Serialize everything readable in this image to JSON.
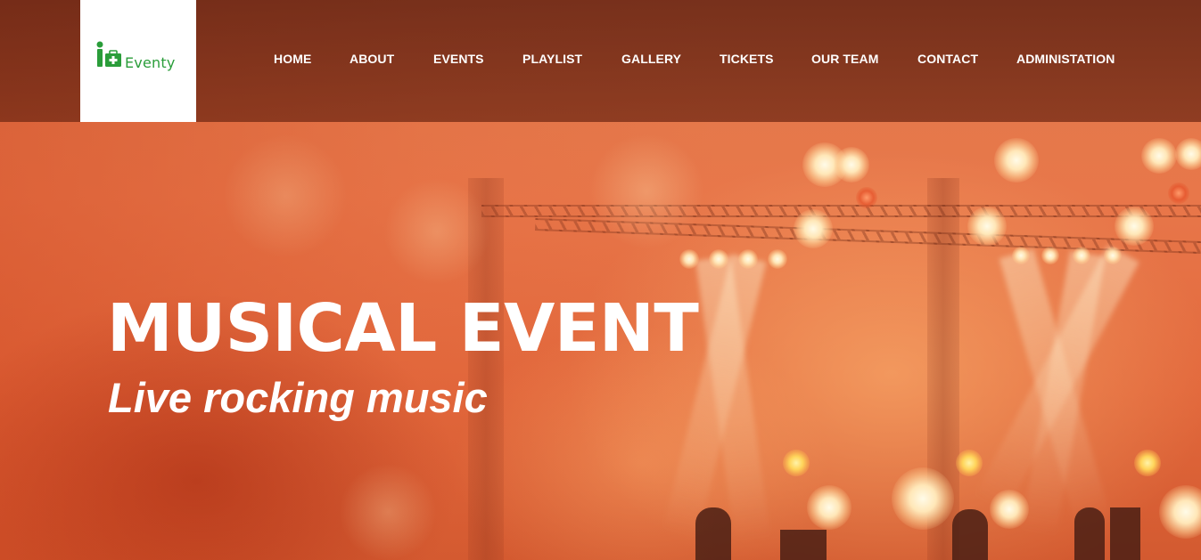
{
  "brand": {
    "name": "Eventy",
    "accent_color": "#2a9d3a",
    "icon": "person-briefcase-icon"
  },
  "nav": {
    "items": [
      {
        "label": "HOME"
      },
      {
        "label": "ABOUT"
      },
      {
        "label": "EVENTS"
      },
      {
        "label": "PLAYLIST"
      },
      {
        "label": "GALLERY"
      },
      {
        "label": "TICKETS"
      },
      {
        "label": "OUR TEAM"
      },
      {
        "label": "CONTACT"
      },
      {
        "label": "ADMINISTATION"
      }
    ]
  },
  "hero": {
    "title": "MUSICAL EVENT",
    "subtitle": "Live rocking music",
    "background_color": "#e2683c",
    "overlay_color": "#5a1c0e"
  }
}
